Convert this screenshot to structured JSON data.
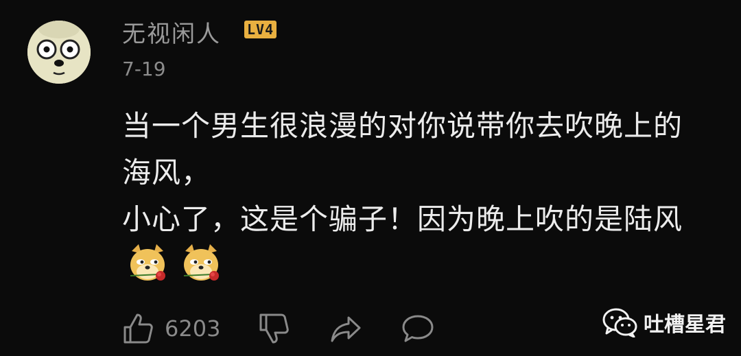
{
  "comment": {
    "username": "无视闲人",
    "level": "LV4",
    "date": "7-19",
    "text_lines": [
      "当一个男生很浪漫的对你说带你去吹晚上的",
      "海风，",
      "小心了，这是个骗子！因为晚上吹的是陆风"
    ],
    "emojis": [
      "doge-rose-emoji",
      "doge-rose-emoji"
    ]
  },
  "actions": {
    "like_count": "6203",
    "icons": [
      "thumbs-up-icon",
      "thumbs-down-icon",
      "share-icon",
      "comment-icon"
    ]
  },
  "watermark": {
    "label": "吐槽星君",
    "icon": "wechat-icon"
  },
  "colors": {
    "background": "#0b0b0b",
    "username": "#9a9a9a",
    "level_badge": "#e9b040",
    "text": "#ececec",
    "muted": "#8a8a8a"
  }
}
